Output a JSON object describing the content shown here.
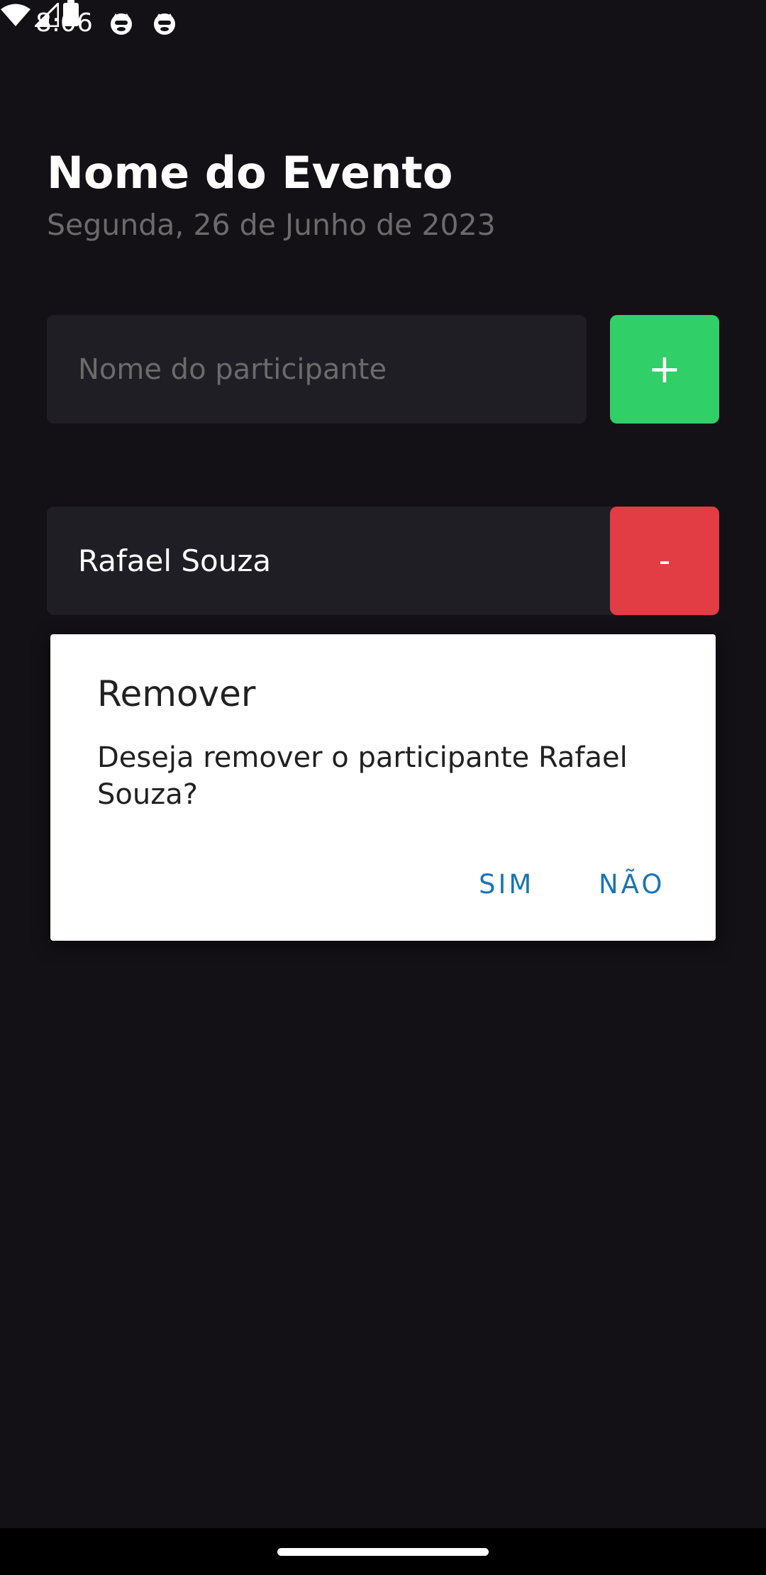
{
  "status_bar": {
    "time": "8:06",
    "app_icons": [
      "cat-face-icon",
      "cat-face-icon"
    ],
    "system_icons": [
      "wifi-icon",
      "cellular-signal-icon",
      "battery-icon"
    ]
  },
  "event": {
    "title": "Nome do Evento",
    "date": "Segunda, 26 de Junho de 2023"
  },
  "add_form": {
    "placeholder": "Nome do participante",
    "value": "",
    "add_label": "+"
  },
  "participants": [
    {
      "name": "Rafael Souza",
      "remove_label": "-"
    }
  ],
  "dialog": {
    "title": "Remover",
    "message": "Deseja remover o participante Rafael Souza?",
    "confirm_label": "SIM",
    "cancel_label": "NÃO"
  },
  "colors": {
    "background": "#131016",
    "surface": "#1f1e25",
    "add_button": "#31cf67",
    "remove_button": "#e23c44",
    "dialog_action": "#1976b6"
  }
}
